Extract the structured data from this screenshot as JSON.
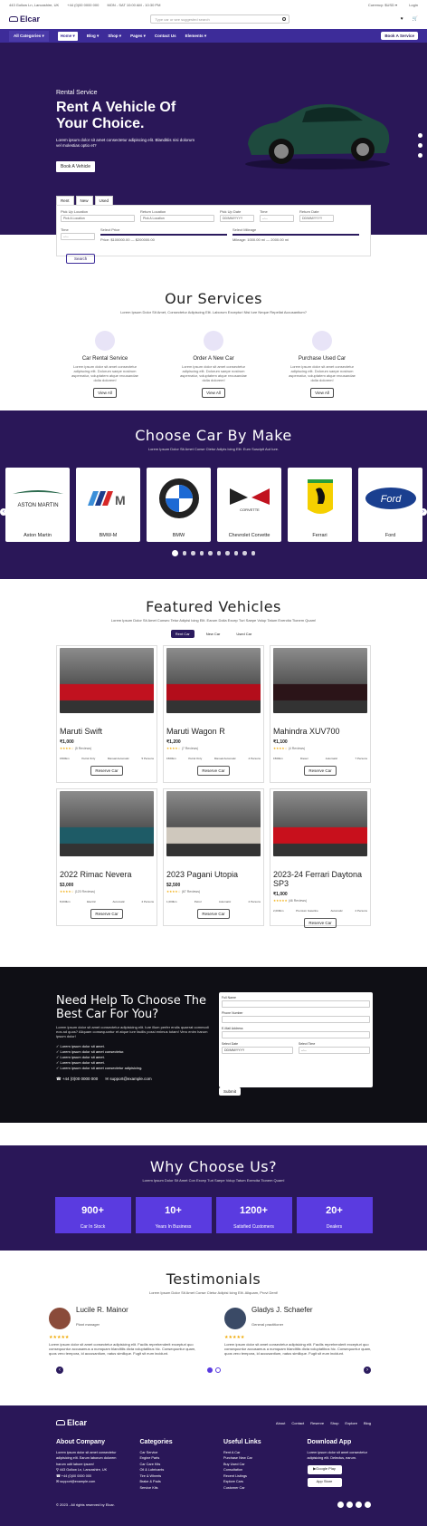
{
  "topbar": {
    "address": "443 Gollow Ln, Lancashire, UK",
    "phone": "+44 (0)00 0000 000",
    "hours": "MON - SAT 10:00 AM - 10:30 PM",
    "currency": "Currency: $USD ▾",
    "login": "Login"
  },
  "header": {
    "brand": "Elcar",
    "search_placeholder": "Type car or see suggested search"
  },
  "nav": {
    "categories": "All Categories ▾",
    "items": [
      "Home ▾",
      "Blog ▾",
      "Shop ▾",
      "Pages ▾",
      "Contact Us",
      "Elements ▾"
    ],
    "book": "Book A Service"
  },
  "hero": {
    "sub": "Rental Service",
    "title": "Rent A Vehicle Of Your Choice.",
    "text": "Lorem ipsum dolor sit amet consectetur adipiscing elit. Blanditiis nisi dolorum vel molestias optio et?",
    "button": "Book A Vehicle"
  },
  "search_form": {
    "tabs": [
      "Rent",
      "New",
      "Used"
    ],
    "pickup_label": "Pick Up Location",
    "pickup_value": "Pick A Location",
    "return_label": "Return Location",
    "return_value": "Pick A Location",
    "pickup_date_label": "Pick Up Date",
    "return_date_label": "Return Date",
    "date_placeholder": "DD/MM/YYYY",
    "time_label": "Time",
    "time_placeholder": "--:--",
    "price_label": "Select Price",
    "price_value": "Price: $100000.00 — $200000.00",
    "mileage_label": "Select Mileage",
    "mileage_value": "Mileage: 1000.00 mi — 2000.00 mi",
    "search_button": "Search"
  },
  "services": {
    "title": "Our Services",
    "sub": "Lorem Ipsum Dolor Sit Amet, Consectetur Adipiscing Elit. Laborum Excepturi Nisi Iure Neque Repellat Accusantium?",
    "items": [
      {
        "title": "Car Rental Service",
        "text": "Lorem ipsum dolor sit amet consectetur adipiscing elit. Dolorum saepe nostrum aspernatur, voluptatem atque recusandae dolia dolorem!",
        "button": "View All"
      },
      {
        "title": "Order A New Car",
        "text": "Lorem ipsum dolor sit amet consectetur adipiscing elit. Dolorum saepe nostrum aspernatur, voluptatem atque recusandae dolia dolorem!",
        "button": "View All"
      },
      {
        "title": "Purchase Used Car",
        "text": "Lorem ipsum dolor sit amet consectetur adipiscing elit. Dolorum saepe nostrum aspernatur, voluptatem atque recusandae dolia dolorem!",
        "button": "View All"
      }
    ]
  },
  "makes": {
    "title": "Choose Car By Make",
    "sub": "Lorem Ipsum Dolor Sit Amet Conse Ctetur Adipis Icing Elit. Eum Suscipit Aut Iure.",
    "logo_text_aston": "ASTON MARTIN",
    "logo_text_corvette": "CORVETTE",
    "logo_text_ford": "Ford",
    "items": [
      "Aston Martin",
      "BMW-M",
      "BMW",
      "Chevrolet Corvette",
      "Ferrari",
      "Ford"
    ]
  },
  "featured": {
    "title": "Featured Vehicles",
    "sub": "Lorem Ipsum Dolor Sit Amet Consec Tetur Adipisi Icing Elit. Earum Dolla Excep Turi Saepe Volup Tatum Exercita Tionem Quam!",
    "tabs": [
      "Rent Car",
      "New Car",
      "Used Car"
    ],
    "vehicles": [
      {
        "name": "Maruti Swift",
        "price": "₹1,000",
        "rating": "★★★★☆",
        "reviews": "(5 Reviews)",
        "specs": [
          "1500km",
          "Petrol Only",
          "Manual Automatic",
          "5 Persons"
        ],
        "button": "Reserve Car",
        "color": "#c1121f"
      },
      {
        "name": "Maruti Wagon R",
        "price": "₹1,200",
        "rating": "★★★★☆",
        "reviews": "(7 Reviews)",
        "specs": [
          "1500km",
          "Petrol Only",
          "Manual Automatic",
          "4 Persons"
        ],
        "button": "Reserve Car",
        "color": "#b30d1b"
      },
      {
        "name": "Mahindra XUV700",
        "price": "₹1,100",
        "rating": "★★★★☆",
        "reviews": "(4 Reviews)",
        "specs": [
          "1500km",
          "Diesel",
          "Automatic",
          "7 Persons"
        ],
        "button": "Reserve Car",
        "color": "#2b1418"
      },
      {
        "name": "2022 Rimac Nevera",
        "price": "$3,000",
        "rating": "★★★★☆",
        "reviews": "(120 Reviews)",
        "specs": [
          "8,000km",
          "Electric",
          "Automatic",
          "2 Persons"
        ],
        "button": "Reserve Car",
        "color": "#1e5b66"
      },
      {
        "name": "2023 Pagani Utopia",
        "price": "$2,500",
        "rating": "★★★★☆",
        "reviews": "(67 Reviews)",
        "specs": [
          "1,000km",
          "Petrol",
          "Automatic",
          "2 Persons"
        ],
        "button": "Reserve Car",
        "color": "#cfc8bd"
      },
      {
        "name": "2023-24 Ferrari Daytona SP3",
        "price": "₹1,000",
        "rating": "★★★★★",
        "reviews": "(46 Reviews)",
        "specs": [
          "2,000km",
          "Premium Gasoline",
          "Automatic",
          "2 Persons"
        ],
        "button": "Reserve Car",
        "color": "#c8101c"
      }
    ]
  },
  "help": {
    "title": "Need Help To Choose The Best Car For You?",
    "text": "Lorem ipsum dolor sit amet consectetur adipisicing elit. Iure illum perfer endis quaerat commodi eos ad quos? Aliquam consequuntur et atque iure facilis possi enimus totam! Vero enim harum ipsum dolor!",
    "list": [
      "Lorem ipsum dolor sit amet.",
      "Lorem ipsum dolor sit amet consectetur.",
      "Lorem ipsum dolor sit amet.",
      "Lorem ipsum dolor sit amet.",
      "Lorem ipsum dolor sit amet consectetur adipisicing."
    ],
    "phone": "+44 (0)00 0000 000",
    "email": "support@example.com",
    "form": {
      "full_name": "Full Name",
      "phone": "Phone Number",
      "email": "E-Mail Address",
      "date": "Select Date",
      "date_placeholder": "DD/MM/YYYY",
      "time": "Select Time",
      "time_placeholder": "--:--",
      "submit": "Submit"
    }
  },
  "why": {
    "title": "Why Choose Us?",
    "sub": "Lorem Ipsum Dolor Sit Amet Con Excep Turi Saepe Volup Tatum Exercita Tionem Quam!",
    "stats": [
      {
        "value": "900+",
        "label": "Car In Stock"
      },
      {
        "value": "10+",
        "label": "Years In Business"
      },
      {
        "value": "1200+",
        "label": "Satisfied Customers"
      },
      {
        "value": "20+",
        "label": "Dealers"
      }
    ]
  },
  "testimonials": {
    "title": "Testimonials",
    "sub": "Lorem Ipsum Dolor Sit Amet Conse Ctetur Adipisi Icing Elit. Aliquam, Provi Dent!",
    "items": [
      {
        "name": "Lucile R. Mainor",
        "role": "Plant manager",
        "stars": "★★★★★",
        "text": "Lorem ipsum dolor sit amet consectetur adipisicing elit. Facilis reprehenderit excepturi quo consequuntur accusamus a numquam blanditiis dicta voluptatibus hic. Consequuntur quam, quos vero tempora, id accusantium, natus similique. Fugit sit eum incidunt."
      },
      {
        "name": "Gladys J. Schaefer",
        "role": "General practitioner",
        "stars": "★★★★★",
        "text": "Lorem ipsum dolor sit amet consectetur adipisicing elit. Facilis reprehenderit excepturi quo consequuntur accusamus a numquam blanditiis dicta voluptatibus hic. Consequuntur quam, quos vero tempora, id accusantium, natus similique. Fugit sit eum incidunt."
      }
    ]
  },
  "footer": {
    "brand": "Elcar",
    "links": [
      "About",
      "Contact",
      "Reserve",
      "Shop",
      "Explore",
      "Blog"
    ],
    "about_title": "About Company",
    "about_text": "Lorem ipsum dolor sit amet consectetur adipisicing elit. Earum laborum dolorem harum odit labore ipsam!",
    "address": "443 Gollow Ln, Lancashire, UK",
    "phone": "+44 (0)00 0000 000",
    "email": "support@example.com",
    "categories_title": "Categories",
    "categories": [
      "Car Service",
      "Engine Parts",
      "Car Care Kits",
      "Oil & Lubricants",
      "Tire & Wheels",
      "Brake & Pads",
      "Service Kits"
    ],
    "useful_title": "Useful Links",
    "useful": [
      "Rent A Car",
      "Purchase New Car",
      "Buy Used Car",
      "Consultation",
      "Recent Listings",
      "Explore Cars",
      "Customer Car"
    ],
    "app_title": "Download App",
    "app_text": "Lorem ipsum dolor sit amet consectetur adipisicing elit. Delectus, earum.",
    "google": "Google Play",
    "apple": "App Store",
    "copyright": "© 2023 - All rights reserved by Elcar."
  }
}
